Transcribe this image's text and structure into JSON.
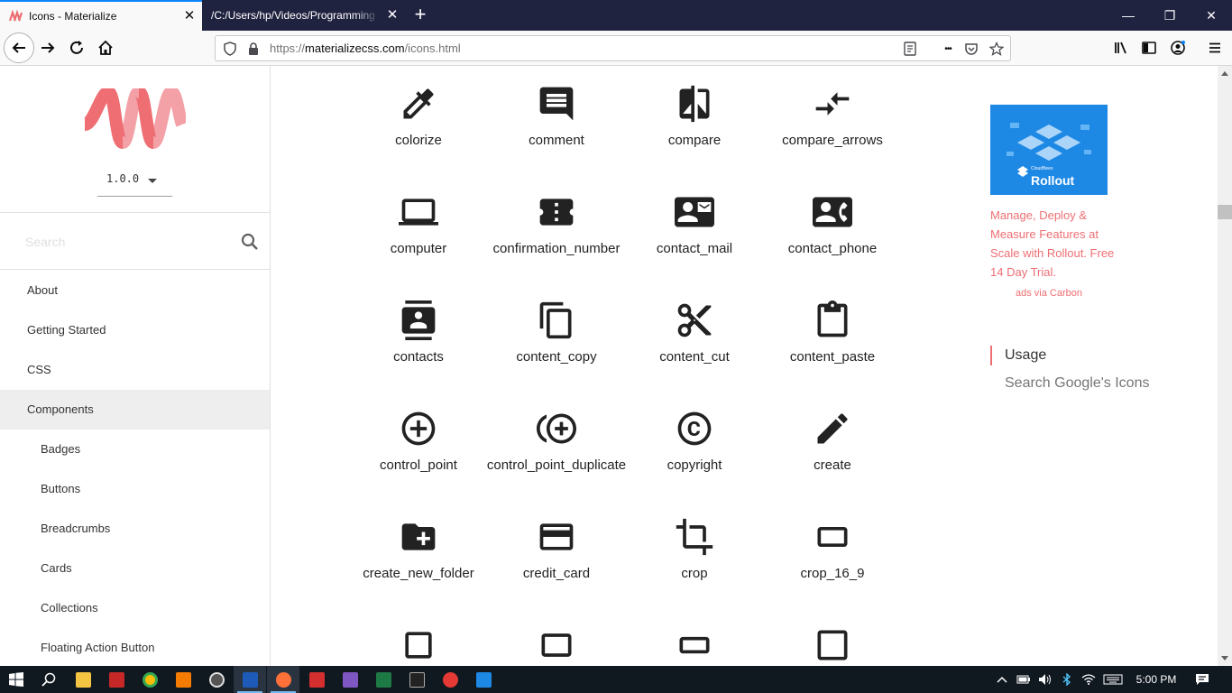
{
  "browser": {
    "tabs": [
      {
        "title": "Icons - Materialize",
        "active": true
      },
      {
        "title": "/C:/Users/hp/Videos/Programming",
        "active": false
      }
    ],
    "tab_close_glyph": "✕",
    "new_tab_glyph": "+",
    "window_controls": {
      "minimize": "—",
      "restore": "❐",
      "close": "✕"
    },
    "url_scheme": "https://",
    "url_host": "materializecss.com",
    "url_path": "/icons.html",
    "overflow_glyph": "•••"
  },
  "sidebar": {
    "version": "1.0.0",
    "search_placeholder": "Search",
    "items": [
      {
        "label": "About",
        "sub": false,
        "active": false
      },
      {
        "label": "Getting Started",
        "sub": false,
        "active": false
      },
      {
        "label": "CSS",
        "sub": false,
        "active": false
      },
      {
        "label": "Components",
        "sub": false,
        "active": true
      },
      {
        "label": "Badges",
        "sub": true,
        "active": false
      },
      {
        "label": "Buttons",
        "sub": true,
        "active": false
      },
      {
        "label": "Breadcrumbs",
        "sub": true,
        "active": false
      },
      {
        "label": "Cards",
        "sub": true,
        "active": false
      },
      {
        "label": "Collections",
        "sub": true,
        "active": false
      },
      {
        "label": "Floating Action Button",
        "sub": true,
        "active": false
      }
    ]
  },
  "icons": [
    "colorize",
    "comment",
    "compare",
    "compare_arrows",
    "computer",
    "confirmation_number",
    "contact_mail",
    "contact_phone",
    "contacts",
    "content_copy",
    "content_cut",
    "content_paste",
    "control_point",
    "control_point_duplicate",
    "copyright",
    "create",
    "create_new_folder",
    "credit_card",
    "crop",
    "crop_16_9",
    "",
    "",
    "",
    ""
  ],
  "ad": {
    "brand": "CloudBees",
    "product": "Rollout",
    "text": "Manage, Deploy & Measure Features at Scale with Rollout. Free 14 Day Trial.",
    "via": "ads via Carbon"
  },
  "toc": {
    "usage": "Usage",
    "search": "Search Google's Icons"
  },
  "taskbar": {
    "clock": "5:00 PM"
  },
  "colors": {
    "accent": "#ee6e73",
    "tabstrip": "#202340",
    "taskbar": "#101820"
  }
}
